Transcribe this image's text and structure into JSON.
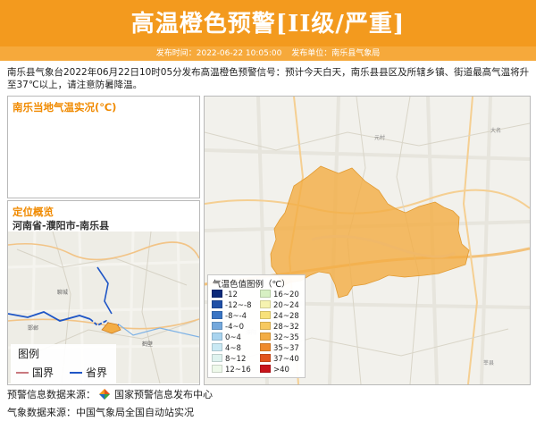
{
  "header": {
    "title": "高温橙色预警[II级/严重]",
    "publish_time": "发布时间：2022-06-22 10:05:00",
    "publisher": "发布单位：南乐县气象局",
    "accent_color": "#f39a1e"
  },
  "summary": "南乐县气象台2022年06月22日10时05分发布高温橙色预警信号：预计今天白天，南乐县县区及所辖乡镇、街道最高气温将升至37℃以上，请注意防暑降温。",
  "live_panel": {
    "title": "南乐当地气温实况(℃)"
  },
  "location_panel": {
    "title": "定位概览",
    "location": "河南省-濮阳市-南乐县",
    "legend": {
      "title": "图例",
      "items": [
        {
          "label": "国界",
          "color": "#c9797f"
        },
        {
          "label": "省界",
          "color": "#1f56c6"
        }
      ]
    }
  },
  "temp_legend": {
    "title": "气温色值图例（℃）",
    "items": [
      {
        "label": "-12",
        "color": "#0d2a7a"
      },
      {
        "label": "-12~-8",
        "color": "#1f4fa6"
      },
      {
        "label": "-8~-4",
        "color": "#3a75c4"
      },
      {
        "label": "-4~0",
        "color": "#74a8dc"
      },
      {
        "label": "0~4",
        "color": "#a9d4ef"
      },
      {
        "label": "4~8",
        "color": "#c9e9f4"
      },
      {
        "label": "8~12",
        "color": "#dff3ef"
      },
      {
        "label": "12~16",
        "color": "#eef9ea"
      },
      {
        "label": "16~20",
        "color": "#d7f0c3"
      },
      {
        "label": "20~24",
        "color": "#f6f3b0"
      },
      {
        "label": "24~28",
        "color": "#f8e17a"
      },
      {
        "label": "28~32",
        "color": "#f7c95f"
      },
      {
        "label": "32~35",
        "color": "#f3ad45"
      },
      {
        "label": "35~37",
        "color": "#ef8a2c"
      },
      {
        "label": "37~40",
        "color": "#e2541d"
      },
      {
        "label": ">40",
        "color": "#c8141a"
      }
    ]
  },
  "footer": {
    "source_warning": "预警信息数据来源：",
    "source_warning_name": "国家预警信息发布中心",
    "source_weather": "气象数据来源：中国气象局全国自动站实况"
  }
}
